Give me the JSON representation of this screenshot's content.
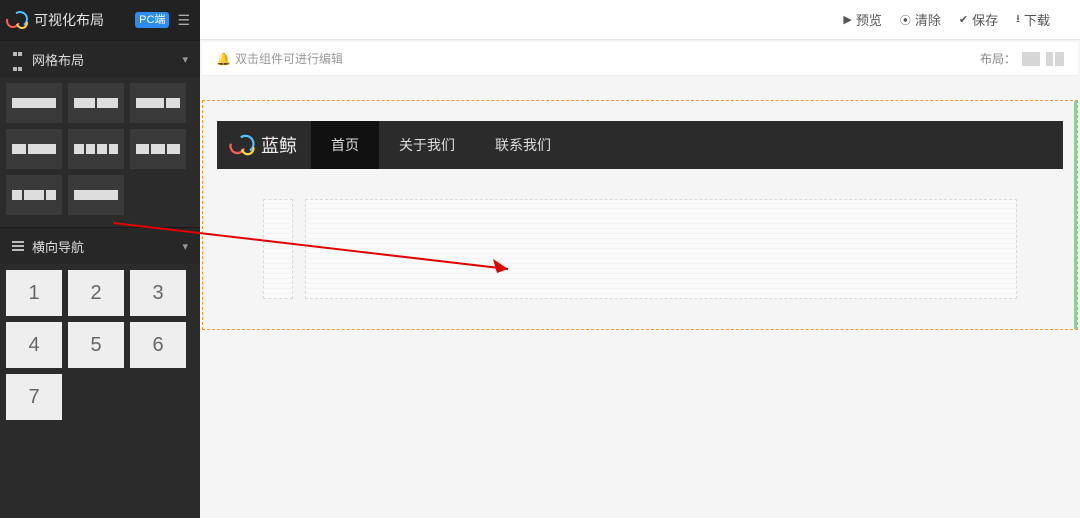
{
  "app": {
    "title": "可视化布局",
    "mode_badge": "PC端"
  },
  "sidebar": {
    "sections": [
      {
        "title": "网格布局"
      },
      {
        "title": "横向导航"
      }
    ],
    "nav_numbers": [
      "1",
      "2",
      "3",
      "4",
      "5",
      "6",
      "7"
    ],
    "grid_presets": [
      {
        "cols": [
          1
        ]
      },
      {
        "cols": [
          1,
          1
        ]
      },
      {
        "cols": [
          2,
          1
        ]
      },
      {
        "cols": [
          1,
          2
        ]
      },
      {
        "cols": [
          1,
          1,
          1,
          1
        ]
      },
      {
        "cols": [
          1,
          1,
          1
        ]
      },
      {
        "cols": [
          1,
          2,
          1
        ]
      },
      {
        "cols": [
          3
        ]
      }
    ]
  },
  "topbar": {
    "buttons": [
      {
        "label": "预览",
        "icon": "▶"
      },
      {
        "label": "清除",
        "icon": "⦿"
      },
      {
        "label": "保存",
        "icon": "✔"
      },
      {
        "label": "下载",
        "icon": "⭳"
      }
    ]
  },
  "hint": {
    "bell_icon": "🔔",
    "text": "双击组件可进行编辑",
    "layout_label": "布局："
  },
  "canvas": {
    "navbar": {
      "brand": "蓝鲸",
      "items": [
        {
          "label": "首页",
          "active": true
        },
        {
          "label": "关于我们",
          "active": false
        },
        {
          "label": "联系我们",
          "active": false
        }
      ]
    }
  }
}
